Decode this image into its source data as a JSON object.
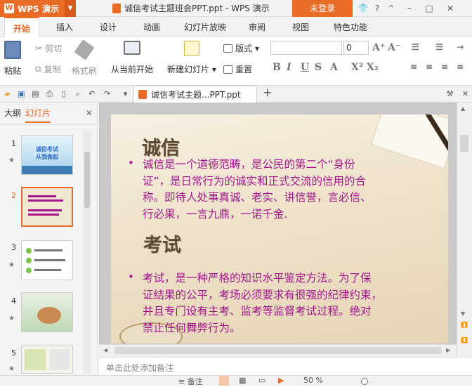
{
  "app": {
    "name": "WPS 演示",
    "doc_title": "诚信考试主题班会PPT.ppt - WPS 演示",
    "login": "未登录"
  },
  "tabs": [
    "开始",
    "插入",
    "设计",
    "动画",
    "幻灯片放映",
    "审阅",
    "视图",
    "特色功能"
  ],
  "ribbon": {
    "paste": "粘贴",
    "cut": "剪切",
    "copy": "复制",
    "format_painter": "格式刷",
    "from_current": "从当前开始",
    "new_slide": "新建幻灯片",
    "layout": "版式",
    "reset": "重置",
    "font_size": "0",
    "font_name": ""
  },
  "doc_tab": "诚信考试主题...PPT.ppt",
  "left_pane": {
    "tab_outline": "大纲",
    "tab_slides": "幻灯片",
    "thumbs": [
      {
        "num": "1",
        "text": "诚信考试\n从我做起"
      },
      {
        "num": "2",
        "text": ""
      },
      {
        "num": "3",
        "text": ""
      },
      {
        "num": "4",
        "text": ""
      },
      {
        "num": "5",
        "text": ""
      }
    ]
  },
  "slide": {
    "heading1": "诚信",
    "bullet1_lines": [
      "诚信是一个道德范畴，是公民的第二个“身份",
      "证”，是日常行为的诚实和正式交流的信用的合",
      "称。即待人处事真诚、老实、讲信誉，言必信、",
      "行必果，一言九鼎，一诺千金."
    ],
    "heading2": "考试",
    "bullet2_lines": [
      "考试，是一种严格的知识水平鉴定方法。为了保",
      "证结果的公平，考场必须要求有很强的纪律约束，",
      "并且专门设有主考、监考等监督考试过程。绝对",
      "禁止任何舞弊行为。"
    ]
  },
  "notes_placeholder": "单击此处添加备注",
  "status": {
    "notes": "备注",
    "zoom": "50 %"
  },
  "colors": {
    "accent": "#e86b26",
    "body_text": "#a3168c"
  }
}
